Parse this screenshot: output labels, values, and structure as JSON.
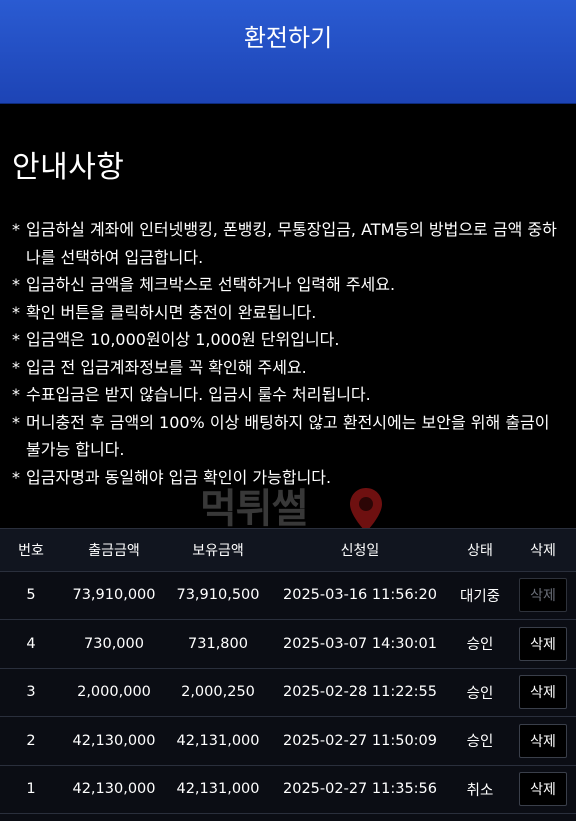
{
  "header": {
    "title": "환전하기"
  },
  "notice": {
    "title": "안내사항",
    "items": [
      "입금하실 계좌에 인터넷뱅킹, 폰뱅킹, 무통장입금, ATM등의 방법으로 금액 중하나를 선택하여 입금합니다.",
      "입금하신 금액을 체크박스로 선택하거나 입력해 주세요.",
      "확인 버튼을 클릭하시면 충전이 완료됩니다.",
      "입금액은 10,000원이상 1,000원 단위입니다.",
      "입금 전 입금계좌정보를 꼭 확인해 주세요.",
      "수표입금은 받지 않습니다. 입금시 룰수 처리됩니다.",
      "머니충전 후 금액의 100% 이상 배팅하지 않고 환전시에는 보안을 위해 출금이 불가능 합니다.",
      "입금자명과 동일해야 입금 확인이 가능합니다."
    ],
    "bullet": "*",
    "watermark": "먹튀썰"
  },
  "table": {
    "headers": [
      "번호",
      "출금금액",
      "보유금액",
      "신청일",
      "상태",
      "삭제"
    ],
    "rows": [
      {
        "no": "5",
        "withdraw": "73,910,000",
        "balance": "73,910,500",
        "date": "2025-03-16 11:56:20",
        "status": "대기중",
        "delete": "삭제",
        "disabled": true
      },
      {
        "no": "4",
        "withdraw": "730,000",
        "balance": "731,800",
        "date": "2025-03-07 14:30:01",
        "status": "승인",
        "delete": "삭제",
        "disabled": false
      },
      {
        "no": "3",
        "withdraw": "2,000,000",
        "balance": "2,000,250",
        "date": "2025-02-28 11:22:55",
        "status": "승인",
        "delete": "삭제",
        "disabled": false
      },
      {
        "no": "2",
        "withdraw": "42,130,000",
        "balance": "42,131,000",
        "date": "2025-02-27 11:50:09",
        "status": "승인",
        "delete": "삭제",
        "disabled": false
      },
      {
        "no": "1",
        "withdraw": "42,130,000",
        "balance": "42,131,000",
        "date": "2025-02-27 11:35:56",
        "status": "취소",
        "delete": "삭제",
        "disabled": false
      }
    ]
  }
}
